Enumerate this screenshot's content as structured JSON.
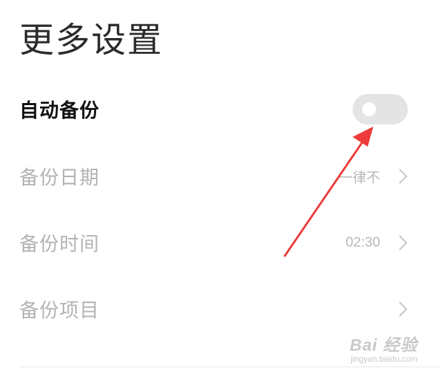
{
  "header": {
    "title": "更多设置"
  },
  "settings": {
    "items": [
      {
        "label": "自动备份",
        "control": "toggle",
        "toggle_state": "off"
      },
      {
        "label": "备份日期",
        "value": "一律不"
      },
      {
        "label": "备份时间",
        "value": "02:30"
      },
      {
        "label": "备份项目",
        "value": ""
      }
    ]
  },
  "icons": {
    "chevron": "chevron-right-icon",
    "annotation": "red-arrow"
  },
  "colors": {
    "active_text": "#111111",
    "disabled_text": "#b3b3b3",
    "toggle_off_track": "#e4e4e4",
    "annotation_arrow": "#ee3a3a"
  },
  "watermark": {
    "logo": "Bai 经验",
    "url": "jingyan.baidu.com"
  }
}
